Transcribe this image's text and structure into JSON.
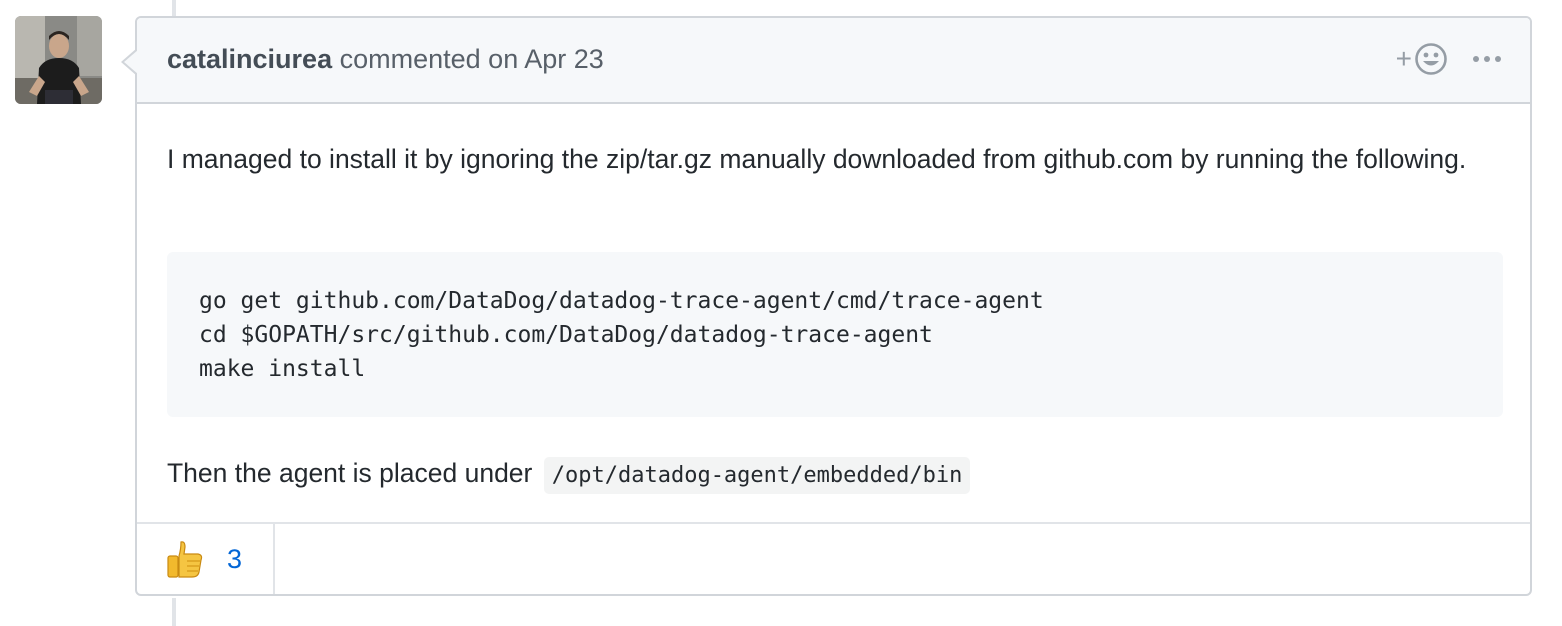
{
  "comment": {
    "author": "catalinciurea",
    "action_text": "commented on Apr 23",
    "body": {
      "paragraph1": "I managed to install it by ignoring the zip/tar.gz manually downloaded from github.com by running the following.",
      "code_lines": [
        "go get github.com/DataDog/datadog-trace-agent/cmd/trace-agent",
        "cd $GOPATH/src/github.com/DataDog/datadog-trace-agent",
        "make install"
      ],
      "paragraph2_prefix": "Then the agent is placed under",
      "paragraph2_code": "/opt/datadog-agent/embedded/bin"
    },
    "header_actions": {
      "add_reaction_plus": "+",
      "add_reaction_icon": "smiley-icon",
      "more_icon": "kebab-horizontal-icon"
    },
    "reactions": [
      {
        "icon": "thumbs-up-icon",
        "count": "3"
      }
    ]
  },
  "colors": {
    "header_bg": "#f6f8fa",
    "border": "#d1d5da",
    "link_blue": "#0366d6",
    "text": "#24292e",
    "muted": "#586069"
  }
}
